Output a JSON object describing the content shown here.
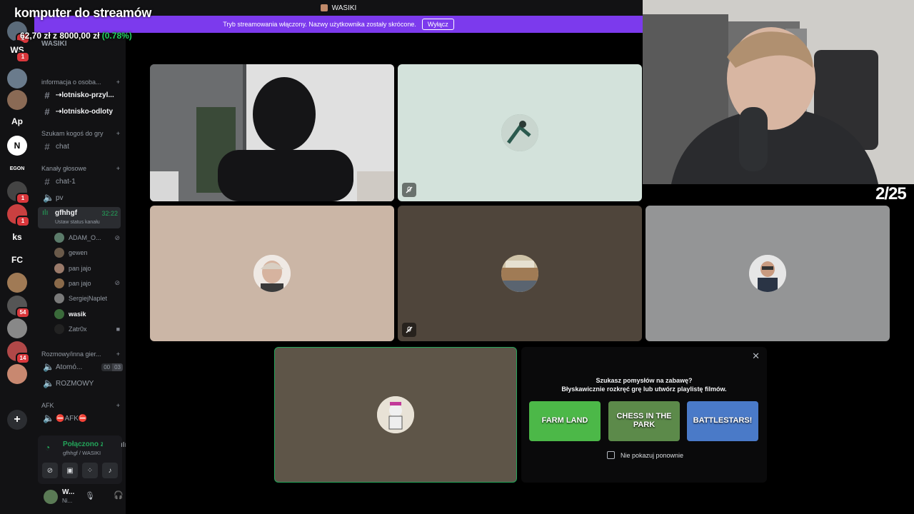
{
  "overlay": {
    "title": "komputer do streamów",
    "money_text": "62,70 zł z 8000,00 zł",
    "money_pct": "(0.78%)",
    "counter": "2/25"
  },
  "topbar": {
    "title": "WASIKI"
  },
  "streambar": {
    "message": "Tryb streamowania włączony. Nazwy użytkownika zostały skrócone.",
    "button": "Wyłącz"
  },
  "rail": {
    "servers": [
      {
        "label": "",
        "badge": "1",
        "color": "#5b6b7a"
      },
      {
        "label": "WS",
        "badge": "1",
        "color": "#121214"
      },
      {
        "label": "",
        "badge": "",
        "color": "#6a7b8c"
      },
      {
        "label": "",
        "badge": "",
        "color": "#8a6a55"
      },
      {
        "label": "Ap",
        "badge": "",
        "color": "#121214"
      },
      {
        "label": "N",
        "badge": "",
        "color": "#ffffff"
      },
      {
        "label": "EGON",
        "badge": "",
        "color": "#121214"
      },
      {
        "label": "",
        "badge": "1",
        "color": "#444"
      },
      {
        "label": "",
        "badge": "1",
        "color": "#c94040"
      },
      {
        "label": "ks",
        "badge": "",
        "color": "#121214"
      },
      {
        "label": "FC",
        "badge": "",
        "color": "#121214"
      },
      {
        "label": "",
        "badge": "",
        "color": "#a07a55"
      },
      {
        "label": "",
        "badge": "54",
        "color": "#555"
      },
      {
        "label": "",
        "badge": "",
        "color": "#888"
      },
      {
        "label": "",
        "badge": "14",
        "color": "#b04848"
      },
      {
        "label": "",
        "badge": "",
        "color": "#c88870"
      }
    ],
    "add_label": "+"
  },
  "sidebar": {
    "server_name": "WASIKI",
    "categories": [
      {
        "label": "informacja o osoba..."
      },
      {
        "label": "Szukam kogoś do gry"
      },
      {
        "label": "Kanały głosowe"
      },
      {
        "label": "Rozmowy/inna gier..."
      },
      {
        "label": "AFK"
      }
    ],
    "channels": [
      {
        "label": "⇢lotnisko-przyl..."
      },
      {
        "label": "⇢lotnisko-odloty"
      },
      {
        "label": "chat"
      },
      {
        "label": "chat-1"
      },
      {
        "label": "pv"
      },
      {
        "label": "gfhhgf",
        "timer": "32:22",
        "status": "Ustaw status kanału"
      },
      {
        "label": "Atomó...",
        "counts": [
          "00",
          "03"
        ]
      },
      {
        "label": "ROZMOWY"
      },
      {
        "label": "⛔AFK⛔"
      }
    ],
    "voice_users": [
      {
        "name": "ADAM_O...",
        "icon": "mic-off-icon"
      },
      {
        "name": "gewen",
        "icon": ""
      },
      {
        "name": "pan jajo",
        "icon": ""
      },
      {
        "name": "pan jajo",
        "icon": "mic-off-icon"
      },
      {
        "name": "SergiejNaplet",
        "icon": ""
      },
      {
        "name": "wasik",
        "icon": ""
      },
      {
        "name": "Zatr0x",
        "icon": "camera-icon"
      }
    ]
  },
  "voice_panel": {
    "status": "Połączono z cza",
    "location": "gfhhgf / WASIKI"
  },
  "user_panel": {
    "name": "W...",
    "status": "Ni..."
  },
  "game_panel": {
    "title": "Szukasz pomysłów na zabawę?",
    "subtitle": "Błyskawicznie rozkręć grę lub utwórz playlistę filmów.",
    "games": [
      {
        "label": "FARM LAND",
        "color": "#4cb848"
      },
      {
        "label": "CHESS IN THE PARK",
        "color": "#5c8a4a"
      },
      {
        "label": "BATTLESTARS!",
        "color": "#4a7ac8"
      }
    ],
    "checkbox_label": "Nie pokazuj ponownie"
  }
}
